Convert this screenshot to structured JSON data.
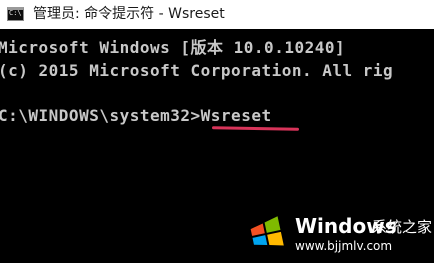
{
  "window": {
    "title": "管理员: 命令提示符 - Wsreset",
    "icon": "cmd-icon"
  },
  "console": {
    "lines": [
      "Microsoft Windows [版本 10.0.10240]",
      "(c) 2015 Microsoft Corporation. All rig",
      "C:\\WINDOWS\\system32>Wsreset"
    ],
    "text_color": "#c8c8c8",
    "background_color": "#000000",
    "highlight_color": "#d8345a"
  },
  "watermark": {
    "logo": "windows-logo-icon",
    "title": "Windows",
    "subtitle_cn": "系统之家",
    "url": "www.bjjmlv.com"
  }
}
